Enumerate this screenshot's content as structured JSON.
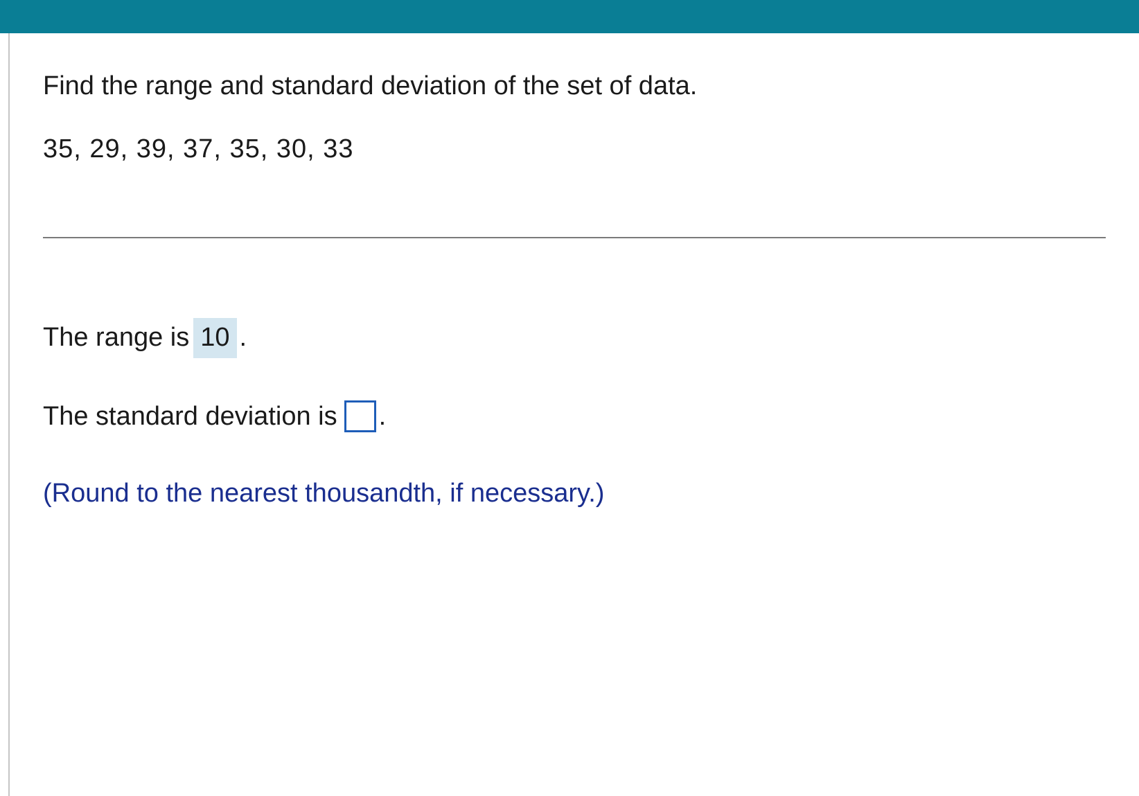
{
  "question": {
    "prompt": "Find the range and standard deviation of the set of data.",
    "data_set": "35, 29, 39, 37, 35, 30, 33"
  },
  "answers": {
    "range_label_pre": "The range is ",
    "range_value": "10",
    "range_label_post": " .",
    "stddev_label_pre": "The standard deviation is ",
    "stddev_value": "",
    "stddev_label_post": "."
  },
  "instruction": "(Round to the nearest thousandth, if necessary.)"
}
